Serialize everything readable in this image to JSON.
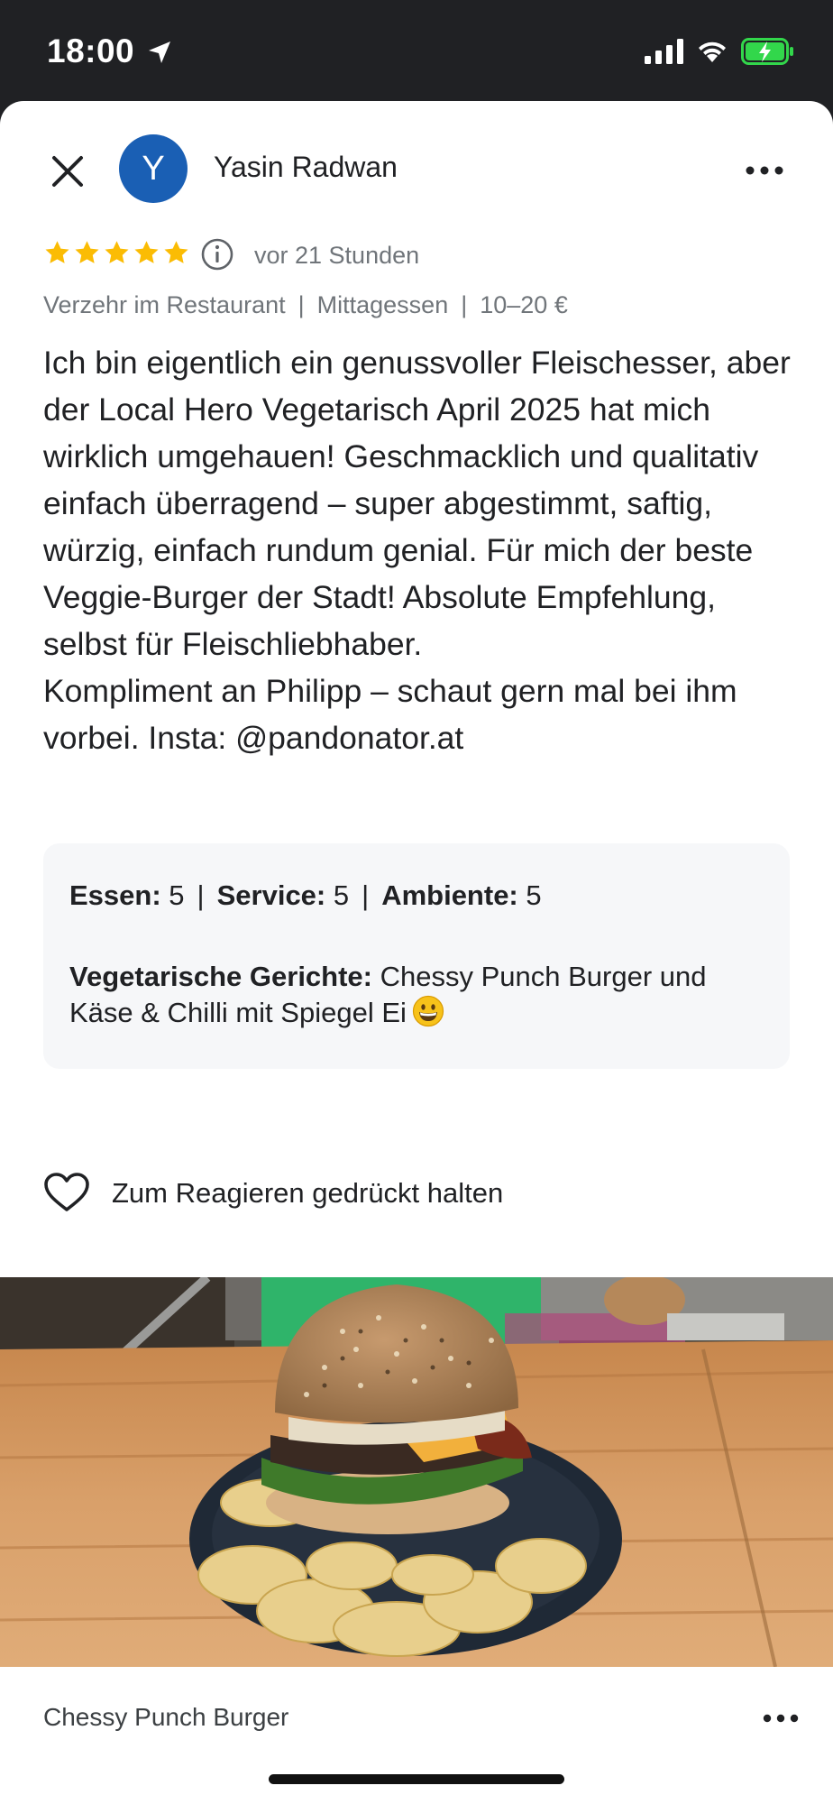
{
  "status_bar": {
    "time": "18:00",
    "icons": [
      "location-arrow-icon",
      "signal-icon",
      "wifi-icon",
      "battery-charging-icon"
    ]
  },
  "header": {
    "close_icon": "close-icon",
    "avatar_letter": "Y",
    "author_name": "Yasin Radwan",
    "more_icon": "more-horizontal-icon"
  },
  "review": {
    "rating": 5,
    "max_rating": 5,
    "time_ago": "vor 21 Stunden",
    "meta": [
      "Verzehr im Restaurant",
      "Mittagessen",
      "10–20 €"
    ],
    "text": "Ich bin eigentlich ein genussvoller Fleischesser, aber der Local Hero Vegetarisch April 2025 hat mich wirklich umgehauen! Geschmacklich und qualitativ einfach überragend – super abgestimmt, saftig, würzig, einfach rundum genial. Für mich der beste Veggie-Burger der Stadt! Absolute Empfehlung, selbst für Fleischliebhaber.\nKompliment an Philipp – schaut gern mal bei ihm vorbei. Insta: @pandonator.at"
  },
  "ratings": {
    "food_label": "Essen:",
    "food_value": "5",
    "service_label": "Service:",
    "service_value": "5",
    "ambience_label": "Ambiente:",
    "ambience_value": "5",
    "veg_label": "Vegetarische Gerichte:",
    "veg_value": "Chessy Punch Burger und Käse & Chilli mit Spiegel Ei"
  },
  "reaction": {
    "label": "Zum Reagieren gedrückt halten"
  },
  "photo": {
    "caption": "Chessy Punch Burger"
  },
  "colors": {
    "star": "#fbbc04",
    "avatar": "#1a5fb4",
    "status_bar": "#202124",
    "battery_fill": "#32d74b"
  }
}
